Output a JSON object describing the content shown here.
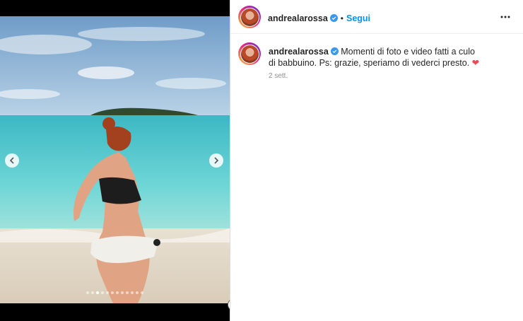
{
  "post": {
    "username": "andrealarossa",
    "separator": "•",
    "follow_label": "Segui",
    "caption_text": "Momenti di foto e video fatti a culo di babbuino. Ps: grazie, speriamo di vederci presto.",
    "caption_emoji": "❤",
    "timestamp": "2 sett."
  },
  "carousel": {
    "slide_count": 12,
    "active_slide": 3
  },
  "colors": {
    "follow": "#0095f6",
    "heart": "#ed4956",
    "verified": "#3897f0"
  },
  "icons": {
    "prev": "chevron-left-icon",
    "next": "chevron-right-icon",
    "more": "more-horizontal-icon",
    "verified": "verified-badge-icon"
  }
}
